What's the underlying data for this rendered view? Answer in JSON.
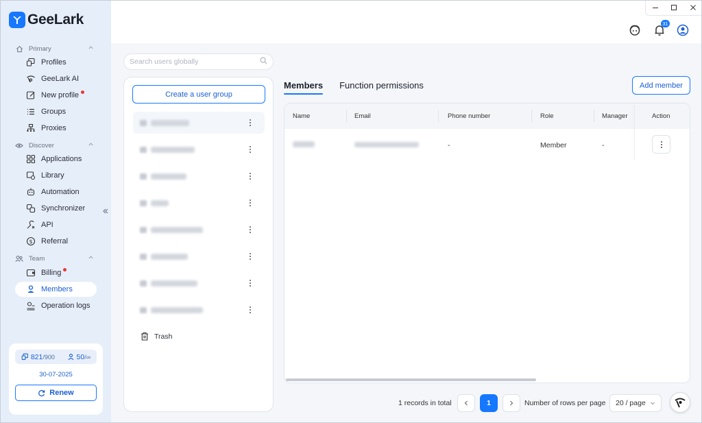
{
  "app": {
    "name": "GeeLark",
    "brand_color": "#1677ff"
  },
  "window_controls": [
    "minimize-icon",
    "maximize-icon",
    "close-icon"
  ],
  "header": {
    "notifications_count": "31",
    "icons": [
      "support-agent-icon",
      "bell-icon",
      "user-account-icon"
    ]
  },
  "sidebar": {
    "sections": [
      {
        "label": "Primary",
        "items": [
          {
            "label": "Profiles",
            "icon": "profiles-icon"
          },
          {
            "label": "GeeLark AI",
            "icon": "ai-eye-icon"
          },
          {
            "label": "New profile",
            "icon": "new-profile-icon",
            "dot": true
          },
          {
            "label": "Groups",
            "icon": "list-icon"
          },
          {
            "label": "Proxies",
            "icon": "network-icon"
          }
        ]
      },
      {
        "label": "Discover",
        "items": [
          {
            "label": "Applications",
            "icon": "apps-grid-icon"
          },
          {
            "label": "Library",
            "icon": "library-icon"
          },
          {
            "label": "Automation",
            "icon": "robot-icon"
          },
          {
            "label": "Synchronizer",
            "icon": "sync-icon"
          },
          {
            "label": "API",
            "icon": "api-icon"
          },
          {
            "label": "Referral",
            "icon": "dollar-icon"
          }
        ]
      },
      {
        "label": "Team",
        "items": [
          {
            "label": "Billing",
            "icon": "wallet-icon",
            "dot": true
          },
          {
            "label": "Members",
            "icon": "member-icon",
            "active": true
          },
          {
            "label": "Operation logs",
            "icon": "logs-icon"
          }
        ]
      }
    ],
    "plan": {
      "profiles_used": "821",
      "profiles_total": "/900",
      "members_used": "50",
      "members_total": "/∞",
      "expiry_date": "30-07-2025",
      "renew_label": "Renew"
    }
  },
  "groups_panel": {
    "search_placeholder": "Search users globally",
    "create_label": "Create a user group",
    "group_count": 8,
    "trash_label": "Trash"
  },
  "members": {
    "tabs": [
      {
        "label": "Members",
        "active": true
      },
      {
        "label": "Function permissions",
        "active": false
      }
    ],
    "add_member_label": "Add member",
    "columns": [
      "Name",
      "Email",
      "Phone number",
      "Role",
      "Manager",
      "Action"
    ],
    "rows": [
      {
        "name": "",
        "email": "",
        "phone": "-",
        "role": "Member",
        "manager": "-"
      }
    ]
  },
  "pagination": {
    "total_text": "1 records in total",
    "current_page": "1",
    "rows_label": "Number of rows per page",
    "rows_value": "20 / page"
  }
}
